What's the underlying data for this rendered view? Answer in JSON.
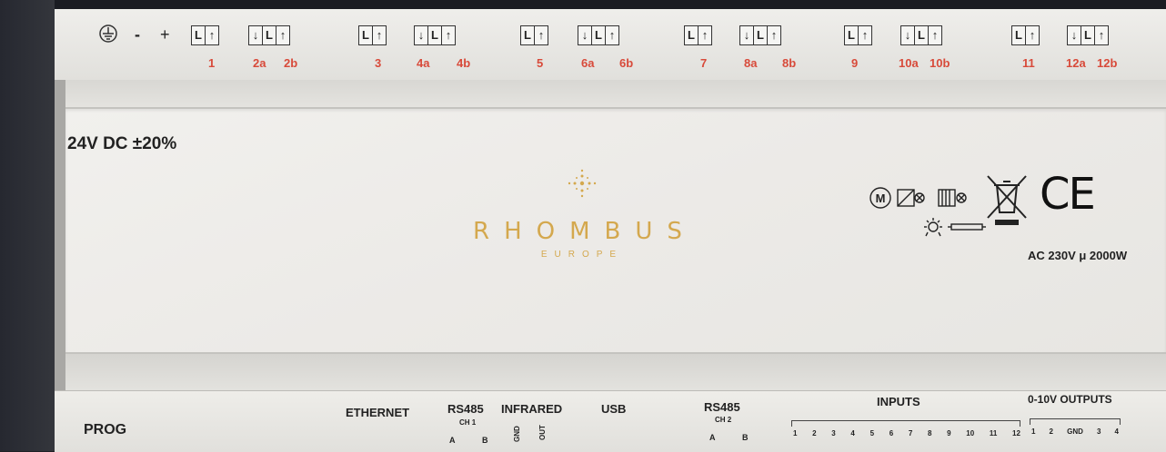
{
  "top": {
    "terminal_letters": {
      "L": "L",
      "up": "↑",
      "down": "↓"
    },
    "symbols": {
      "minus": "-",
      "plus": "+"
    },
    "labels": [
      "1",
      "2a",
      "2b",
      "3",
      "4a",
      "4b",
      "5",
      "6a",
      "6b",
      "7",
      "8a",
      "8b",
      "9",
      "10a",
      "10b",
      "11",
      "12a",
      "12b"
    ]
  },
  "front": {
    "voltage": "24V DC ±20%",
    "ac_rating": "AC 230V μ 2000W",
    "ce_mark": "CE",
    "motor_letter": "M"
  },
  "watermark": {
    "main": "RHOMBUS",
    "sub": "EUROPE"
  },
  "bottom": {
    "prog": "PROG",
    "ethernet": "ETHERNET",
    "rs485_1": "RS485",
    "ch1": "CH 1",
    "a1": "A",
    "b1": "B",
    "infrared": "INFRARED",
    "gnd": "GND",
    "out": "OUT",
    "usb": "USB",
    "rs485_2": "RS485",
    "ch2": "CH 2",
    "a2": "A",
    "b2": "B",
    "inputs": "INPUTS",
    "input_numbers": [
      "1",
      "2",
      "3",
      "4",
      "5",
      "6",
      "7",
      "8",
      "9",
      "10",
      "11",
      "12"
    ],
    "outputs": "0-10V OUTPUTS",
    "output_numbers": [
      "1",
      "2",
      "GND",
      "3",
      "4"
    ]
  },
  "colors": {
    "label_red": "#d84a3a",
    "logo_gold": "#d4a84e"
  }
}
